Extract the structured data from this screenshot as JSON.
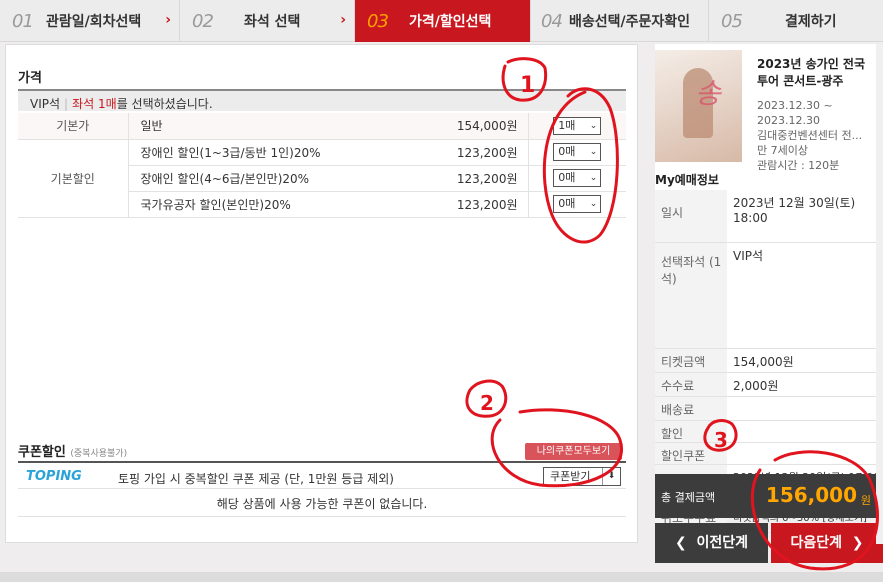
{
  "steps": [
    {
      "num": "01",
      "label": "관람일/회차선택",
      "active": false
    },
    {
      "num": "02",
      "label": "좌석 선택",
      "active": false
    },
    {
      "num": "03",
      "label": "가격/할인선택",
      "active": true
    },
    {
      "num": "04",
      "label": "배송선택/주문자확인",
      "active": false
    },
    {
      "num": "05",
      "label": "결제하기",
      "active": false
    }
  ],
  "price": {
    "title": "가격",
    "seat_grade": "VIP석",
    "seat_word": "좌석",
    "seat_count": "1매",
    "seat_suffix": "를 선택하셨습니다.",
    "rows": [
      {
        "category": "기본가",
        "name": "일반",
        "amount": "154,000원",
        "qty": "1매"
      },
      {
        "category": "기본할인",
        "name": "장애인 할인(1~3급/동반 1인)20%",
        "amount": "123,200원",
        "qty": "0매"
      },
      {
        "category": "",
        "name": "장애인 할인(4~6급/본인만)20%",
        "amount": "123,200원",
        "qty": "0매"
      },
      {
        "category": "",
        "name": "국가유공자 할인(본인만)20%",
        "amount": "123,200원",
        "qty": "0매"
      }
    ]
  },
  "coupon": {
    "title": "쿠폰할인",
    "note": "(중복사용불가)",
    "my_coupons_button": "나의쿠폰모두보기",
    "brand": "TOPING",
    "text": "토핑 가입 시 중복할인 쿠폰 제공 (단, 1만원 등급 제외)",
    "receive_button": "쿠폰받기",
    "empty": "해당 상품에 사용 가능한 쿠폰이 없습니다."
  },
  "show": {
    "title": "2023년 송가인 전국 투어 콘서트-광주",
    "date_from": "2023.12.30 ~",
    "date_to": "2023.12.30",
    "venue": "김대중컨벤션센터 전...",
    "age": "만 7세이상",
    "runtime": "관람시간 : 120분"
  },
  "my": {
    "title": "My예매정보",
    "rows": [
      {
        "key": "일시",
        "value": "2023년 12월 30일(토) 18:00"
      },
      {
        "key": "선택좌석 (1석)",
        "value": "VIP석"
      },
      {
        "key": "티켓금액",
        "value": "154,000원"
      },
      {
        "key": "수수료",
        "value": "2,000원"
      },
      {
        "key": "배송료",
        "value": ""
      },
      {
        "key": "할인",
        "value": ""
      },
      {
        "key": "할인쿠폰",
        "value": ""
      },
      {
        "key": "취소기한",
        "value": "2023년 12월 29일(금) 17:00"
      },
      {
        "key": "취소수수료",
        "value": "티켓금액의 0~30% [상세보기]"
      }
    ],
    "total_label": "총 결제금액",
    "total_value": "156,000",
    "total_unit": "원"
  },
  "buttons": {
    "prev": "이전단계",
    "next": "다음단계"
  },
  "annotations": {
    "one": "1",
    "two": "2",
    "three": "3"
  },
  "colors": {
    "accent": "#c8171e",
    "total": "#ffa600",
    "dark": "#3c3c3c"
  }
}
